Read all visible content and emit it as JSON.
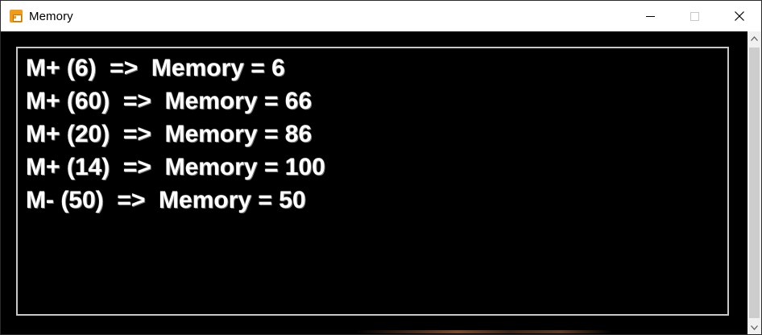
{
  "window": {
    "title": "Memory"
  },
  "controls": {
    "minimize": "minimize",
    "maximize": "maximize",
    "close": "close"
  },
  "log": {
    "lines": [
      "M+ (6)  =>  Memory = 6",
      "M+ (60)  =>  Memory = 66",
      "M+ (20)  =>  Memory = 86",
      "M+ (14)  =>  Memory = 100",
      "M- (50)  =>  Memory = 50"
    ]
  },
  "icons": {
    "app": "memory-app-icon",
    "minimize": "minimize-icon",
    "maximize": "maximize-icon",
    "close": "close-icon",
    "scroll_up": "chevron-up-icon",
    "scroll_down": "chevron-down-icon"
  },
  "colors": {
    "app_icon": "#f29b16",
    "background": "#000000",
    "text": "#ffffff",
    "panel_border": "#c8c8c8"
  }
}
